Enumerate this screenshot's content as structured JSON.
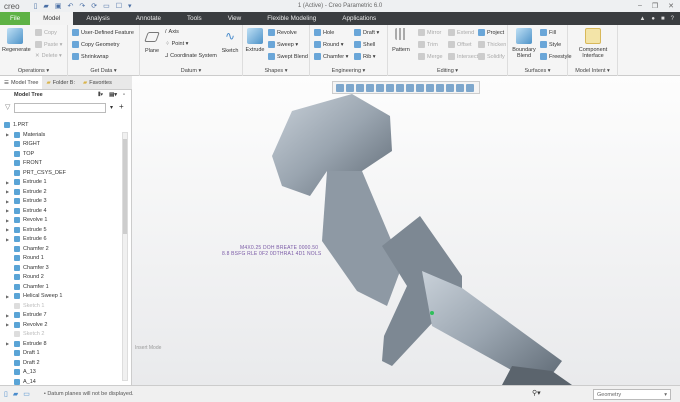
{
  "app": {
    "logo": "creo",
    "title": "1 (Active) - Creo Parametric 6.0"
  },
  "tabs": [
    "File",
    "Model",
    "Analysis",
    "Annotate",
    "Tools",
    "View",
    "Flexible Modeling",
    "Applications"
  ],
  "ribbon": {
    "operations": {
      "label": "Operations ▾",
      "regenerate": "Regenerate",
      "copy": "Copy",
      "paste": "Paste ▾",
      "delete": "Delete ▾"
    },
    "getdata": {
      "label": "Get Data ▾",
      "udf": "User-Defined Feature",
      "copygeom": "Copy Geometry",
      "shrinkwrap": "Shrinkwrap"
    },
    "datum": {
      "label": "Datum ▾",
      "plane": "Plane",
      "axis": "Axis",
      "point": "Point ▾",
      "csys": "Coordinate System",
      "sketch": "Sketch"
    },
    "shapes": {
      "label": "Shapes ▾",
      "extrude": "Extrude",
      "revolve": "Revolve",
      "sweep": "Sweep ▾",
      "sweptblend": "Swept Blend"
    },
    "engineering": {
      "label": "Engineering ▾",
      "hole": "Hole",
      "round": "Round ▾",
      "chamfer": "Chamfer ▾",
      "draft": "Draft ▾",
      "shell": "Shell",
      "rib": "Rib ▾"
    },
    "editing": {
      "label": "Editing ▾",
      "pattern": "Pattern",
      "mirror": "Mirror",
      "trim": "Trim",
      "merge": "Merge",
      "extend": "Extend",
      "offset": "Offset",
      "intersect": "Intersect",
      "project": "Project",
      "thicken": "Thicken",
      "solidify": "Solidify"
    },
    "surfaces": {
      "label": "Surfaces ▾",
      "boundary": "Boundary Blend",
      "fill": "Fill",
      "style": "Style",
      "freestyle": "Freestyle"
    },
    "intent": {
      "label": "Model Intent ▾",
      "ci": "Component Interface"
    }
  },
  "panel": {
    "tabs": [
      "Model Tree",
      "Folder B:",
      "Favorites"
    ],
    "header": "Model Tree",
    "filter_value": ""
  },
  "tree": [
    {
      "label": "1.PRT",
      "exp": false
    },
    {
      "label": "Materials",
      "exp": true
    },
    {
      "label": "RIGHT"
    },
    {
      "label": "TOP"
    },
    {
      "label": "FRONT"
    },
    {
      "label": "PRT_CSYS_DEF"
    },
    {
      "label": "Extrude 1",
      "exp": true
    },
    {
      "label": "Extrude 2",
      "exp": true
    },
    {
      "label": "Extrude 3",
      "exp": true
    },
    {
      "label": "Extrude 4",
      "exp": true
    },
    {
      "label": "Revolve 1",
      "exp": true
    },
    {
      "label": "Extrude 5",
      "exp": true
    },
    {
      "label": "Extrude 6",
      "exp": true
    },
    {
      "label": "Chamfer 2"
    },
    {
      "label": "Round 1"
    },
    {
      "label": "Chamfer 3"
    },
    {
      "label": "Round 2"
    },
    {
      "label": "Chamfer 1"
    },
    {
      "label": "Helical Sweep 1",
      "exp": true
    },
    {
      "label": "Sketch 1",
      "dis": true
    },
    {
      "label": "Extrude 7",
      "exp": true
    },
    {
      "label": "Revolve 2",
      "exp": true
    },
    {
      "label": "Sketch 2",
      "dis": true
    },
    {
      "label": "Extrude 8",
      "exp": true
    },
    {
      "label": "Draft 1"
    },
    {
      "label": "Draft 2"
    },
    {
      "label": "A_13"
    },
    {
      "label": "A_14"
    }
  ],
  "graphics": {
    "mode": "Insert Mode",
    "dim_line1": "M4X0.25 DOH BREATE 0000.50",
    "dim_line2": "8.8 BSFG RLE 0F2 0DTHRA1 4D1 NOLS"
  },
  "status": {
    "message": "• Datum planes will not be displayed.",
    "filter": "Geometry"
  }
}
